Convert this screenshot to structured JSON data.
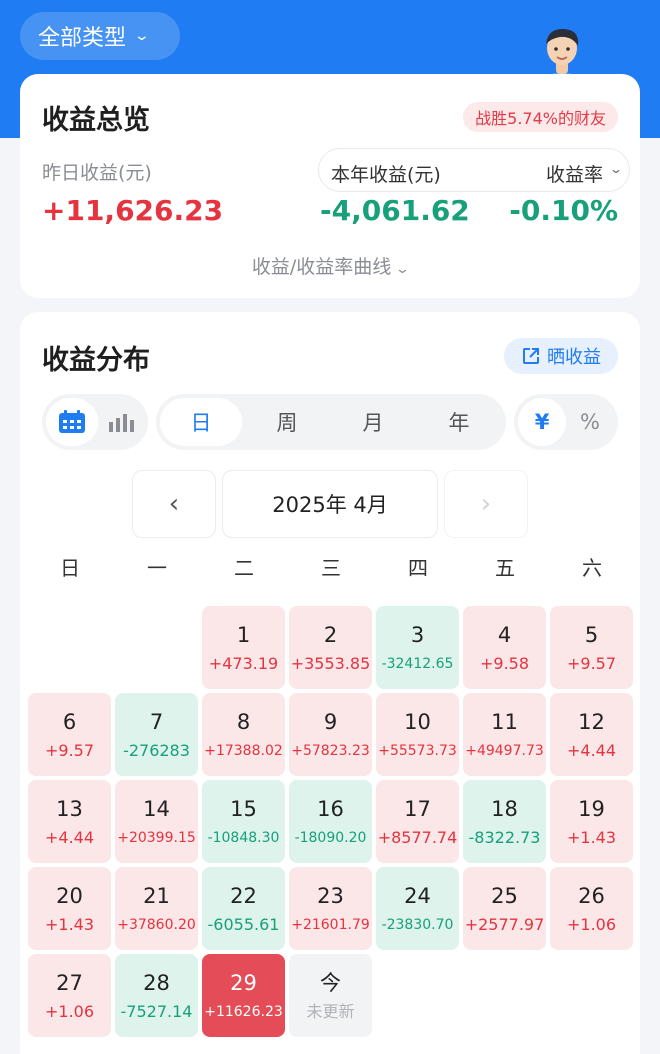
{
  "type_filter": {
    "label": "全部类型"
  },
  "overview": {
    "title": "收益总览",
    "beat_badge": "战胜5.74%的财友",
    "yesterday_label": "昨日收益(元)",
    "yesterday_value": "+11,626.23",
    "year_label": "本年收益(元)",
    "year_value": "-4,061.62",
    "rate_label": "收益率",
    "rate_value": "-0.10%",
    "curve_link": "收益/收益率曲线"
  },
  "distribution": {
    "title": "收益分布",
    "share_label": "晒收益",
    "period_tabs": [
      "日",
      "周",
      "月",
      "年"
    ],
    "active_period": "日",
    "unit_options": [
      "¥",
      "%"
    ],
    "month_label": "2025年 4月",
    "weekdays": [
      "日",
      "一",
      "二",
      "三",
      "四",
      "五",
      "六"
    ],
    "days": [
      {
        "day": "1",
        "value": "+473.19",
        "kind": "pos"
      },
      {
        "day": "2",
        "value": "+3553.85",
        "kind": "pos"
      },
      {
        "day": "3",
        "value": "-32412.65",
        "kind": "neg"
      },
      {
        "day": "4",
        "value": "+9.58",
        "kind": "pos"
      },
      {
        "day": "5",
        "value": "+9.57",
        "kind": "pos"
      },
      {
        "day": "6",
        "value": "+9.57",
        "kind": "pos"
      },
      {
        "day": "7",
        "value": "-276283",
        "kind": "neg"
      },
      {
        "day": "8",
        "value": "+17388.02",
        "kind": "pos"
      },
      {
        "day": "9",
        "value": "+57823.23",
        "kind": "pos"
      },
      {
        "day": "10",
        "value": "+55573.73",
        "kind": "pos"
      },
      {
        "day": "11",
        "value": "+49497.73",
        "kind": "pos"
      },
      {
        "day": "12",
        "value": "+4.44",
        "kind": "pos"
      },
      {
        "day": "13",
        "value": "+4.44",
        "kind": "pos"
      },
      {
        "day": "14",
        "value": "+20399.15",
        "kind": "pos"
      },
      {
        "day": "15",
        "value": "-10848.30",
        "kind": "neg"
      },
      {
        "day": "16",
        "value": "-18090.20",
        "kind": "neg"
      },
      {
        "day": "17",
        "value": "+8577.74",
        "kind": "pos"
      },
      {
        "day": "18",
        "value": "-8322.73",
        "kind": "neg"
      },
      {
        "day": "19",
        "value": "+1.43",
        "kind": "pos"
      },
      {
        "day": "20",
        "value": "+1.43",
        "kind": "pos"
      },
      {
        "day": "21",
        "value": "+37860.20",
        "kind": "pos"
      },
      {
        "day": "22",
        "value": "-6055.61",
        "kind": "neg"
      },
      {
        "day": "23",
        "value": "+21601.79",
        "kind": "pos"
      },
      {
        "day": "24",
        "value": "-23830.70",
        "kind": "neg"
      },
      {
        "day": "25",
        "value": "+2577.97",
        "kind": "pos"
      },
      {
        "day": "26",
        "value": "+1.06",
        "kind": "pos"
      },
      {
        "day": "27",
        "value": "+1.06",
        "kind": "pos"
      },
      {
        "day": "28",
        "value": "-7527.14",
        "kind": "neg"
      },
      {
        "day": "29",
        "value": "+11626.23",
        "kind": "sel"
      },
      {
        "day": "今",
        "value": "未更新",
        "kind": "today"
      }
    ]
  },
  "colors": {
    "brand_blue": "#1f7cf2",
    "gain_red": "#e5343f",
    "loss_green": "#17a07a",
    "selected_red": "#e44d57"
  }
}
